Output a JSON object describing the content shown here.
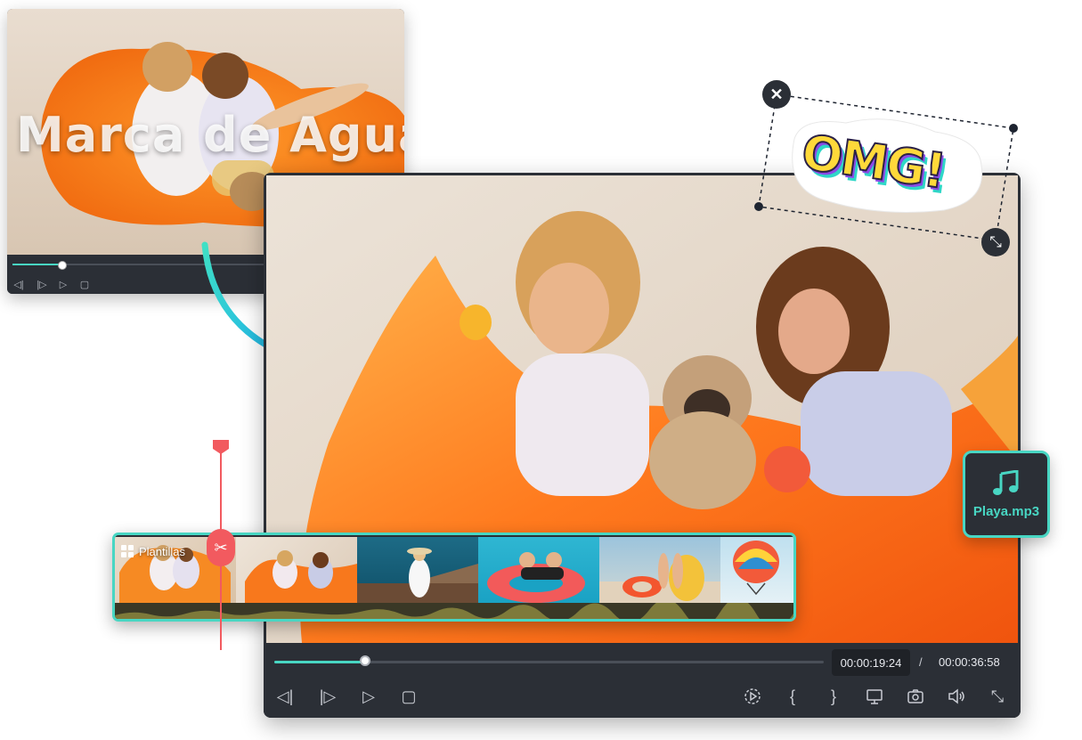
{
  "small_player": {
    "watermark_text": "Marca de Agua",
    "progress": 0.19
  },
  "main_player": {
    "current_time": "00:00:19:24",
    "separator": "/",
    "total_time": "00:00:36:58",
    "progress": 0.17
  },
  "sticker": {
    "text": "OMG!"
  },
  "timeline": {
    "templates_label": "Plantillas"
  },
  "audio_file": {
    "name": "Playa.mp3"
  },
  "colors": {
    "accent": "#48d6c3",
    "playhead": "#f25a5f",
    "panel": "#2b2f36"
  }
}
